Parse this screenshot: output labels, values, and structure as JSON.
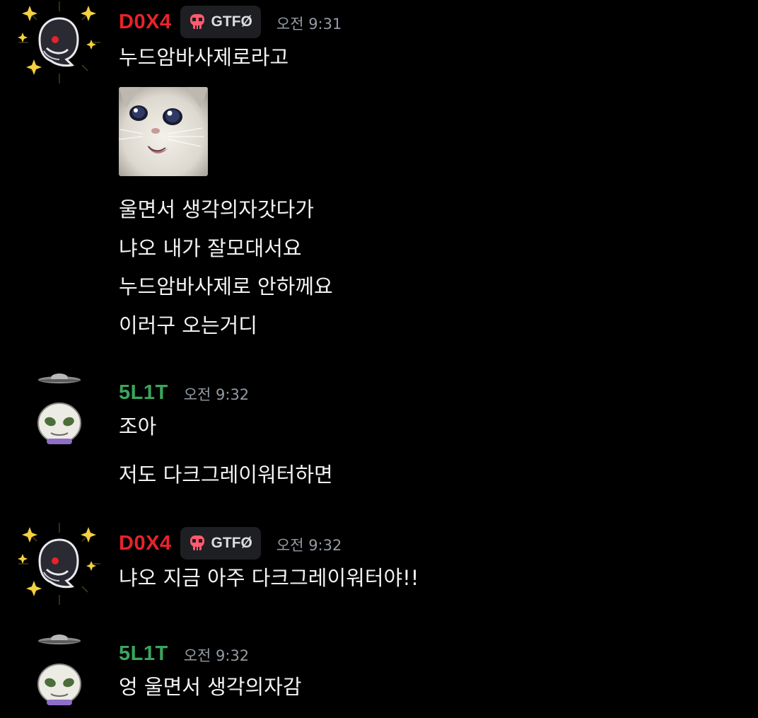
{
  "colors": {
    "background": "#000000",
    "dox_name": "#e8232a",
    "slit_name": "#3ba55d",
    "timestamp": "#949ba4",
    "text": "#f2f3f5",
    "role_bg": "#1e1f22"
  },
  "messages": [
    {
      "username": "D0X4",
      "role": "GTFØ",
      "role_icon": "skull-icon",
      "timestamp": "오전 9:31",
      "lines": [
        "누드암바사제로라고"
      ],
      "attachment": "crying-cat-image",
      "lines_after": [
        "울면서 생각의자갓다가",
        "냐오 내가 잘모대서요",
        "누드암바사제로 안하께요",
        "이러구 오는거디"
      ]
    },
    {
      "username": "5L1T",
      "timestamp": "오전 9:32",
      "lines": [
        "조아",
        "저도 다크그레이워터하면"
      ]
    },
    {
      "username": "D0X4",
      "role": "GTFØ",
      "role_icon": "skull-icon",
      "timestamp": "오전 9:32",
      "lines": [
        "냐오 지금 아주 다크그레이워터야!!"
      ]
    },
    {
      "username": "5L1T",
      "timestamp": "오전 9:32",
      "lines": [
        "엉 울면서 생각의자감"
      ]
    }
  ]
}
